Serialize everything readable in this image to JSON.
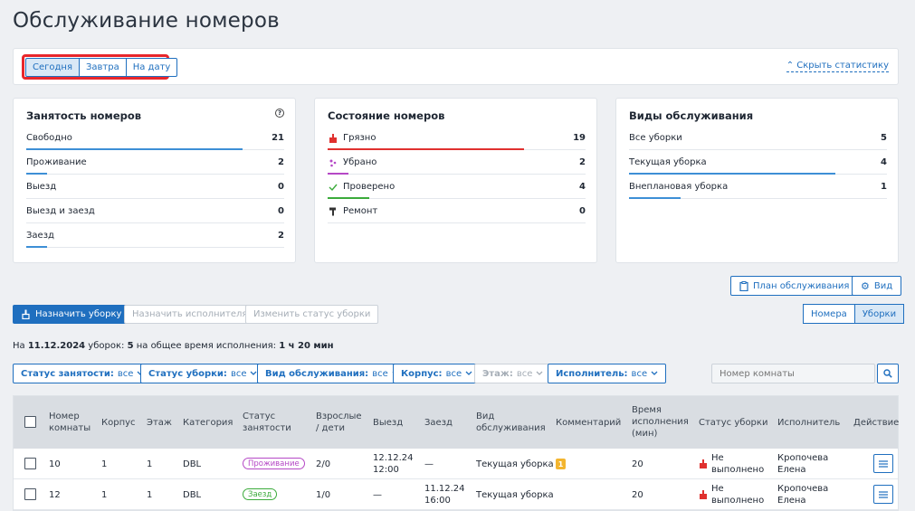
{
  "page": {
    "title": "Обслуживание номеров"
  },
  "date_tabs": [
    {
      "label": "Сегодня",
      "active": true
    },
    {
      "label": "Завтра",
      "active": false
    },
    {
      "label": "На дату",
      "active": false
    }
  ],
  "hide_stats": "Скрыть статистику",
  "occupancy": {
    "title": "Занятость номеров",
    "rows": [
      {
        "label": "Свободно",
        "value": "21",
        "fill": 0.84,
        "color": "#3d8fd6"
      },
      {
        "label": "Проживание",
        "value": "2",
        "fill": 0.08,
        "color": "#3d8fd6"
      },
      {
        "label": "Выезд",
        "value": "0",
        "fill": 0,
        "color": "#3d8fd6"
      },
      {
        "label": "Выезд и заезд",
        "value": "0",
        "fill": 0,
        "color": "#3d8fd6"
      },
      {
        "label": "Заезд",
        "value": "2",
        "fill": 0.08,
        "color": "#3d8fd6"
      }
    ]
  },
  "room_state": {
    "title": "Состояние номеров",
    "rows": [
      {
        "label": "Грязно",
        "value": "19",
        "fill": 0.76,
        "color": "#e0312f",
        "icon": "dirty-icon"
      },
      {
        "label": "Убрано",
        "value": "2",
        "fill": 0.08,
        "color": "#b548c6",
        "icon": "sparkle-icon"
      },
      {
        "label": "Проверено",
        "value": "4",
        "fill": 0.16,
        "color": "#3bab3b",
        "icon": "check-icon"
      },
      {
        "label": "Ремонт",
        "value": "0",
        "fill": 0,
        "color": "#3d8fd6",
        "icon": "paint-roller-icon"
      }
    ]
  },
  "service_types": {
    "title": "Виды обслуживания",
    "rows": [
      {
        "label": "Все уборки",
        "value": "5",
        "fill": 0,
        "color": "#3d8fd6"
      },
      {
        "label": "Текущая уборка",
        "value": "4",
        "fill": 0.8,
        "color": "#3d8fd6"
      },
      {
        "label": "Внеплановая уборка",
        "value": "1",
        "fill": 0.2,
        "color": "#3d8fd6"
      }
    ]
  },
  "actions": {
    "service_plan": "План обслуживания",
    "view": "Вид",
    "assign_cleaning": "Назначить уборку",
    "assign_executor": "Назначить исполнителя",
    "change_status": "Изменить статус уборки",
    "toggle": [
      {
        "label": "Номера",
        "active": false
      },
      {
        "label": "Уборки",
        "active": true
      }
    ]
  },
  "summary": {
    "prefix": "На",
    "date": "11.12.2024",
    "cleanings_label": "уборок:",
    "cleanings": "5",
    "time_label": "на общее время исполнения:",
    "time": "1 ч 20 мин"
  },
  "filters": [
    {
      "name": "Статус занятости:",
      "value": "все",
      "disabled": false
    },
    {
      "name": "Статус уборки:",
      "value": "все",
      "disabled": false
    },
    {
      "name": "Вид обслуживания:",
      "value": "все",
      "disabled": false
    },
    {
      "name": "Корпус:",
      "value": "все",
      "disabled": false
    },
    {
      "name": "Этаж:",
      "value": "все",
      "disabled": true
    },
    {
      "name": "Исполнитель:",
      "value": "все",
      "disabled": false
    }
  ],
  "search": {
    "placeholder": "Номер комнаты"
  },
  "table": {
    "headers": {
      "room": "Номер комнаты",
      "building": "Корпус",
      "floor": "Этаж",
      "category": "Категория",
      "occupancy": "Статус занятости",
      "guests": "Взрослые / дети",
      "departure": "Выезд",
      "arrival": "Заезд",
      "service": "Вид обслуживания",
      "comment": "Комментарий",
      "duration": "Время исполнения (мин)",
      "cleaning_status": "Статус уборки",
      "executor": "Исполнитель",
      "action": "Действие"
    },
    "rows": [
      {
        "room": "10",
        "building": "1",
        "floor": "1",
        "category": "DBL",
        "occupancy": "Проживание",
        "occupancy_color": "#b548c6",
        "guests": "2/0",
        "departure": "12.12.24 12:00",
        "arrival": "—",
        "service": "Текущая уборка",
        "comment": "1",
        "duration": "20",
        "cleaning_status": "Не выполнено",
        "executor": "Кропочева Елена"
      },
      {
        "room": "12",
        "building": "1",
        "floor": "1",
        "category": "DBL",
        "occupancy": "Заезд",
        "occupancy_color": "#3bab3b",
        "guests": "1/0",
        "departure": "—",
        "arrival": "11.12.24 16:00",
        "service": "Текущая уборка",
        "comment": "",
        "duration": "20",
        "cleaning_status": "Не выполнено",
        "executor": "Кропочева Елена"
      }
    ]
  }
}
